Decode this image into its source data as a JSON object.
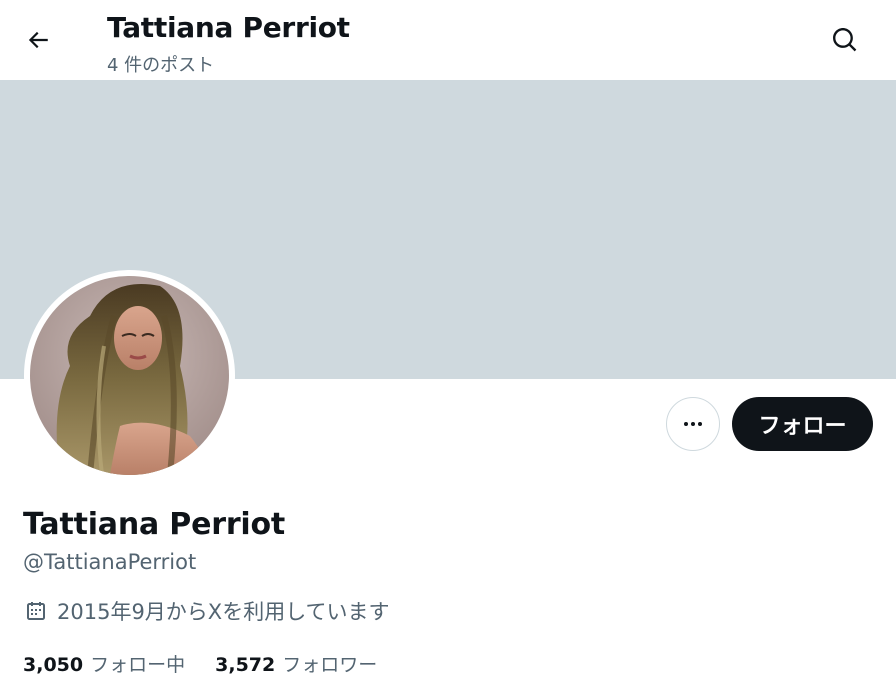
{
  "header": {
    "title": "Tattiana Perriot",
    "post_count": "4 件のポスト",
    "back_icon": "arrow-left-icon",
    "search_icon": "search-icon"
  },
  "profile": {
    "display_name": "Tattiana Perriot",
    "handle": "@TattianaPerriot",
    "joined": "2015年9月からXを利用しています",
    "joined_icon": "calendar-icon",
    "following_count": "3,050",
    "following_label": "フォロー中",
    "followers_count": "3,572",
    "followers_label": "フォロワー"
  },
  "actions": {
    "more_icon": "more-horizontal-icon",
    "follow_label": "フォロー"
  },
  "colors": {
    "banner": "#cfd9de",
    "text_primary": "#0f1419",
    "text_secondary": "#536471",
    "follow_button": "#0f1419"
  }
}
